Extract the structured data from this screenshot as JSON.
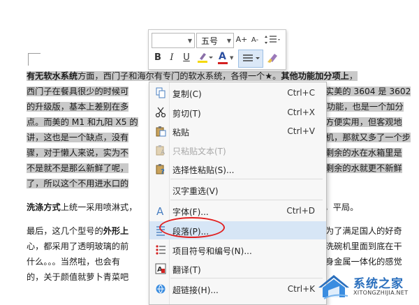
{
  "toolbar": {
    "font_name": "",
    "font_size": "五号",
    "grow_font": "A+",
    "shrink_font": "A-",
    "bold": "B",
    "italic": "I",
    "underline": "U",
    "font_color_letter": "A"
  },
  "document": {
    "lines": [
      {
        "parts": [
          {
            "text": "有无软水系统",
            "bold": true
          },
          {
            "text": "方面，西门子和海尔有专门的软水系统，各得一个★。",
            "bold": false
          },
          {
            "text": "其他功能加分项上",
            "bold": true
          },
          {
            "text": "，",
            "bold": false
          }
        ],
        "highlight": true
      },
      {
        "parts": [
          {
            "text": "西门子在餐具很少的时候可",
            "bold": false
          },
          {
            "text": "实美的 3604 是 3602",
            "bold": false
          }
        ],
        "highlight": true,
        "split": true
      },
      {
        "parts": [
          {
            "text": "的升级版，基本上差别在多",
            "bold": false
          },
          {
            "text": "功能，也是一个加分",
            "bold": false
          }
        ],
        "highlight": true,
        "split": true
      },
      {
        "parts": [
          {
            "text": "点。而美的 M1 和九阳 X5 的",
            "bold": false
          },
          {
            "text": "方便实用，但客观地",
            "bold": false
          }
        ],
        "highlight": true,
        "split": true
      },
      {
        "parts": [
          {
            "text": "讲，这也是一个缺点，没有",
            "bold": false
          },
          {
            "text": "机，那就又多了一个步",
            "bold": false
          }
        ],
        "highlight": true,
        "split": true
      },
      {
        "parts": [
          {
            "text": "骤，对于懒人来说，实为不",
            "bold": false
          },
          {
            "text": "剩余的水在水箱里是",
            "bold": false
          }
        ],
        "highlight": true,
        "split": true
      },
      {
        "parts": [
          {
            "text": "不是就不是那么新鲜了呢，",
            "bold": false
          },
          {
            "text": "剩余的水就更不新鲜",
            "bold": false
          }
        ],
        "highlight": true,
        "split": true
      },
      {
        "parts": [
          {
            "text": "了，所以这个不用进水口的",
            "bold": false
          }
        ],
        "highlight": true,
        "split": true
      },
      {
        "parts": [
          {
            "text": "洗涤方式",
            "bold": true
          },
          {
            "text": "上统一采用喷淋式，",
            "bold": false
          },
          {
            "text": "都不错，平局。",
            "bold": false
          }
        ],
        "highlight": false,
        "split": true
      },
      {
        "parts": [
          {
            "text": "最后，这几个型号的",
            "bold": false
          },
          {
            "text": "外形上",
            "bold": true
          },
          {
            "text": "为了满足国人的好奇",
            "bold": false
          }
        ],
        "highlight": false,
        "split": true
      },
      {
        "parts": [
          {
            "text": "心，都采用了透明玻璃的前",
            "bold": false
          },
          {
            "text": "洗碗机里面到底在干",
            "bold": false
          }
        ],
        "highlight": false,
        "split": true
      },
      {
        "parts": [
          {
            "text": "什么。。。当然啦，也会有",
            "bold": false
          },
          {
            "text": "身金属一体化的感觉",
            "bold": false
          }
        ],
        "highlight": false,
        "split": true
      },
      {
        "parts": [
          {
            "text": "的，关于颜值就萝卜青菜吧",
            "bold": false
          }
        ],
        "highlight": false,
        "split": true
      }
    ]
  },
  "context_menu": {
    "items": [
      {
        "icon": "copy-icon",
        "label": "复制(C)",
        "shortcut": "Ctrl+C",
        "disabled": false
      },
      {
        "icon": "cut-icon",
        "label": "剪切(T)",
        "shortcut": "Ctrl+X",
        "disabled": false
      },
      {
        "icon": "paste-icon",
        "label": "粘贴",
        "shortcut": "Ctrl+V",
        "disabled": false
      },
      {
        "icon": "paste-text-icon",
        "label": "只粘贴文本(T)",
        "shortcut": "",
        "disabled": true
      },
      {
        "icon": "paste-special-icon",
        "label": "选择性粘贴(S)...",
        "shortcut": "",
        "disabled": false
      },
      {
        "icon": "",
        "label": "汉字重选(V)",
        "shortcut": "",
        "disabled": false
      },
      {
        "icon": "font-icon",
        "label": "字体(F)...",
        "shortcut": "Ctrl+D",
        "disabled": false
      },
      {
        "icon": "paragraph-icon",
        "label": "段落(P)...",
        "shortcut": "",
        "disabled": false
      },
      {
        "icon": "bullets-icon",
        "label": "项目符号和编号(N)...",
        "shortcut": "",
        "disabled": false
      },
      {
        "icon": "translate-icon",
        "label": "翻译(T)",
        "shortcut": "",
        "disabled": false
      },
      {
        "icon": "hyperlink-icon",
        "label": "超链接(H)...",
        "shortcut": "Ctrl+K",
        "disabled": false
      }
    ]
  },
  "watermark": {
    "title": "系统之家",
    "url": "XITONGZHIJIA.NET"
  },
  "colors": {
    "selection": "#c9c9c9",
    "menu_hover": "#d7e6f6",
    "annotation_circle": "#e11f1f",
    "font_color_underline": "#d42020",
    "highlight_underline": "#f5d90a"
  }
}
